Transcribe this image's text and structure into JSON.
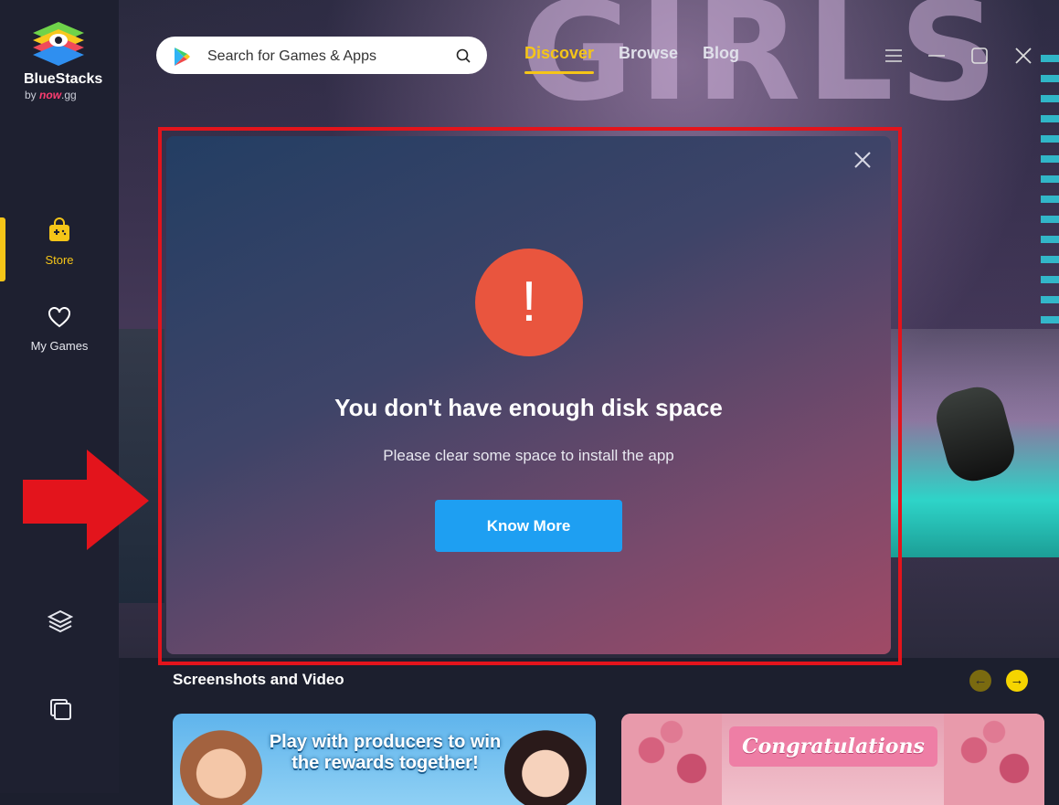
{
  "app": {
    "brand": "BlueStacks",
    "brand_sub_prefix": "by",
    "brand_sub_accent": "now",
    "brand_sub_suffix": ".gg"
  },
  "sidebar": {
    "items": [
      {
        "label": "Store",
        "icon": "store-bag-icon",
        "active": true
      },
      {
        "label": "My Games",
        "icon": "heart-icon",
        "active": false
      }
    ],
    "bottom_icons": [
      "layers-icon",
      "multi-instance-icon"
    ],
    "accent": "#f5c518"
  },
  "header": {
    "search_placeholder": "Search for Games & Apps",
    "tabs": [
      {
        "label": "Discover",
        "active": true
      },
      {
        "label": "Browse",
        "active": false
      },
      {
        "label": "Blog",
        "active": false
      }
    ],
    "window_controls": [
      "menu-icon",
      "minimize-icon",
      "maximize-icon",
      "close-icon"
    ]
  },
  "hero": {
    "title": "GIRLS"
  },
  "modal": {
    "icon": "alert-icon",
    "icon_glyph": "!",
    "title": "You don't have enough disk space",
    "message": "Please clear some space to install the app",
    "button_label": "Know More",
    "colors": {
      "alert": "#e9553e",
      "button": "#1e9ff2",
      "outline": "#e3141c"
    }
  },
  "section": {
    "title": "Screenshots and Video",
    "prev_glyph": "←",
    "next_glyph": "→",
    "thumbnails": [
      {
        "caption": "Play with producers to win the rewards together!"
      },
      {
        "caption": "Congratulations"
      }
    ]
  }
}
